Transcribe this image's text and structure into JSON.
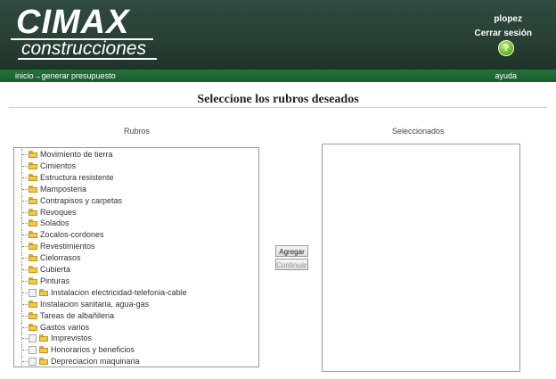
{
  "header": {
    "logo_main": "CIMAX",
    "logo_sub": "construcciones",
    "username": "plopez",
    "logout_label": "Cerrar sesión",
    "help_icon": "?"
  },
  "nav": {
    "crumb_home": "inicio",
    "crumb_arrow": "→",
    "crumb_current": "generar presupuesto",
    "help_label": "ayuda"
  },
  "page": {
    "title": "Seleccione los rubros deseados"
  },
  "rubros": {
    "label": "Rubros",
    "items": [
      {
        "label": "Movimiento de tierra",
        "level": 0
      },
      {
        "label": "Cimientos",
        "level": 0
      },
      {
        "label": "Estructura resistente",
        "level": 0
      },
      {
        "label": "Mamposteria",
        "level": 0
      },
      {
        "label": "Contrapisos y carpetas",
        "level": 0
      },
      {
        "label": "Revoques",
        "level": 0
      },
      {
        "label": "Solados",
        "level": 0
      },
      {
        "label": "Zocalos-cordones",
        "level": 0
      },
      {
        "label": "Revestimientos",
        "level": 0
      },
      {
        "label": "Cielorrasos",
        "level": 0
      },
      {
        "label": "Cubierta",
        "level": 0
      },
      {
        "label": "Pinturas",
        "level": 0
      },
      {
        "label": "Instalacion electricidad-telefonia-cable",
        "level": 1
      },
      {
        "label": "Instalacion sanitaria, agua-gas",
        "level": 0
      },
      {
        "label": "Tareas de albañileria",
        "level": 0
      },
      {
        "label": "Gastos varios",
        "level": 0
      },
      {
        "label": "Imprevistos",
        "level": 1
      },
      {
        "label": "Honorarios y beneficios",
        "level": 1
      },
      {
        "label": "Depreciacion maquinaria",
        "level": 1
      }
    ]
  },
  "seleccionados": {
    "label": "Seleccionados",
    "items": []
  },
  "actions": {
    "add_label": "Agregar",
    "continue_label": "Continuar"
  }
}
